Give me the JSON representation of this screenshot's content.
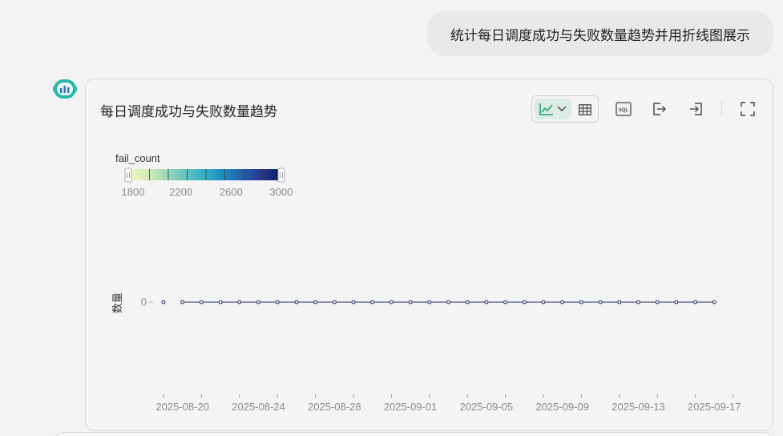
{
  "user_message": "统计每日调度成功与失败数量趋势并用折线图展示",
  "card": {
    "title": "每日调度成功与失败数量趋势"
  },
  "toolbar": {
    "icons": [
      "line-chart-icon",
      "chevron-down-icon",
      "table-icon",
      "sql-icon",
      "export-icon",
      "import-icon",
      "fullscreen-icon"
    ],
    "sql_text": "SQL"
  },
  "colors": {
    "accent": "#1e9e6a",
    "line": "#1f2a6b",
    "gradient": [
      "#f2f7bf",
      "#c7e6b4",
      "#7ecdbb",
      "#41b6c4",
      "#1d91c0",
      "#225ea8",
      "#253494",
      "#081d58"
    ]
  },
  "chart_data": {
    "type": "line",
    "x": [
      "2025-08-19",
      "2025-08-20",
      "2025-08-21",
      "2025-08-22",
      "2025-08-23",
      "2025-08-24",
      "2025-08-25",
      "2025-08-26",
      "2025-08-27",
      "2025-08-28",
      "2025-08-29",
      "2025-08-30",
      "2025-08-31",
      "2025-09-01",
      "2025-09-02",
      "2025-09-03",
      "2025-09-04",
      "2025-09-05",
      "2025-09-06",
      "2025-09-07",
      "2025-09-08",
      "2025-09-09",
      "2025-09-10",
      "2025-09-11",
      "2025-09-12",
      "2025-09-13",
      "2025-09-14",
      "2025-09-15",
      "2025-09-16",
      "2025-09-17",
      "2025-09-18"
    ],
    "x_tick_labels": [
      "2025-08-20",
      "2025-08-24",
      "2025-08-28",
      "2025-09-01",
      "2025-09-05",
      "2025-09-09",
      "2025-09-13",
      "2025-09-17"
    ],
    "series": [
      {
        "values": [
          0,
          0,
          0,
          0,
          0,
          0,
          0,
          0,
          0,
          0,
          0,
          0,
          0,
          0,
          0,
          0,
          0,
          0,
          0,
          0,
          0,
          0,
          0,
          0,
          0,
          0,
          0,
          0,
          0,
          0,
          0
        ]
      }
    ],
    "ylabel": "数量",
    "y_ticks": [
      0
    ],
    "visual_map": {
      "label": "fail_count",
      "min": 1800,
      "max": 3000,
      "ticks": [
        1800,
        2200,
        2600,
        3000
      ],
      "placement": "top-left"
    },
    "grid": false
  }
}
